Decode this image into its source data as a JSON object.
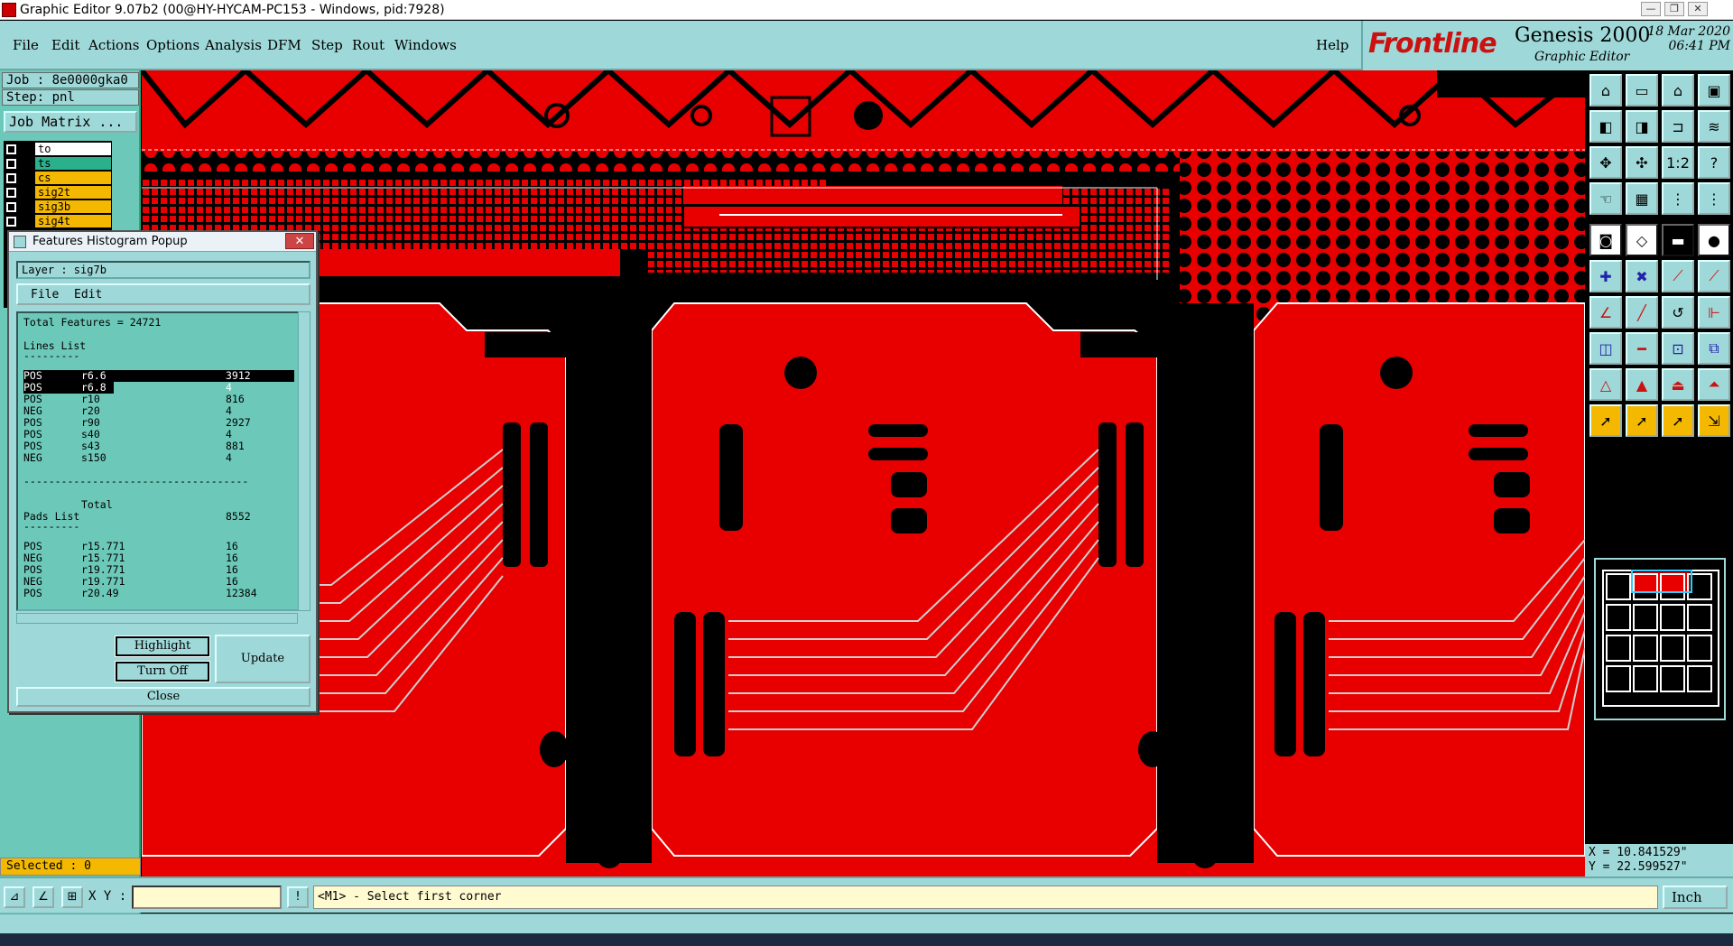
{
  "window": {
    "title": "Graphic Editor 9.07b2 (00@HY-HYCAM-PC153 - Windows, pid:7928)",
    "controls": [
      "—",
      "❐",
      "✕"
    ]
  },
  "menu": {
    "items": [
      "File",
      "Edit",
      "Actions",
      "Options",
      "Analysis",
      "DFM",
      "Step",
      "Rout",
      "Windows"
    ],
    "help": "Help"
  },
  "brand": {
    "logo": "Frontline",
    "product": "Genesis 2000",
    "subtitle": "Graphic Editor",
    "date": "18 Mar 2020",
    "time": "06:41 PM"
  },
  "job": {
    "job_label": "Job : 8e0000gka0",
    "step_label": "Step: pnl",
    "matrix_button": "Job Matrix ..."
  },
  "layers": [
    {
      "name": "to",
      "color": "#ffffff"
    },
    {
      "name": "ts",
      "color": "#2bb08c"
    },
    {
      "name": "cs",
      "color": "#f5b800"
    },
    {
      "name": "sig2t",
      "color": "#f5b800"
    },
    {
      "name": "sig3b",
      "color": "#f5b800"
    },
    {
      "name": "sig4t",
      "color": "#f5b800"
    }
  ],
  "selected": "Selected : 0",
  "popup": {
    "title": "Features Histogram Popup",
    "layer": "Layer :  sig7b",
    "menu": [
      "File",
      "Edit"
    ],
    "total_features": "Total Features = 24721",
    "lines_header": "Lines List",
    "lines_rule": "---------",
    "lines": [
      {
        "pol": "POS",
        "sym": "r6.6",
        "count": "3912",
        "highlighted": true
      },
      {
        "pol": "POS",
        "sym": "r6.8",
        "count": "4",
        "highlighted": true
      },
      {
        "pol": "POS",
        "sym": "r10",
        "count": "816"
      },
      {
        "pol": "NEG",
        "sym": "r20",
        "count": "4"
      },
      {
        "pol": "POS",
        "sym": "r90",
        "count": "2927"
      },
      {
        "pol": "POS",
        "sym": "s40",
        "count": "4"
      },
      {
        "pol": "POS",
        "sym": "s43",
        "count": "881"
      },
      {
        "pol": "NEG",
        "sym": "s150",
        "count": "4"
      }
    ],
    "total_rule": "------------------------------------",
    "total_label": "Total",
    "total_value": "8552",
    "pads_header": "Pads List",
    "pads_rule": "---------",
    "pads": [
      {
        "pol": "POS",
        "sym": "r15.771",
        "count": "16"
      },
      {
        "pol": "NEG",
        "sym": "r15.771",
        "count": "16"
      },
      {
        "pol": "POS",
        "sym": "r19.771",
        "count": "16"
      },
      {
        "pol": "NEG",
        "sym": "r19.771",
        "count": "16"
      },
      {
        "pol": "POS",
        "sym": "r20.49",
        "count": "12384"
      }
    ],
    "buttons": {
      "highlight": "Highlight",
      "turn_off": "Turn Off",
      "update": "Update",
      "close": "Close"
    }
  },
  "status": {
    "xy_label": "X Y :",
    "xy_value": "",
    "prompt": "<M1> - Select first corner",
    "units": "Inch"
  },
  "coords": {
    "x": "X = 10.841529\"",
    "y": "Y = 22.599527\""
  },
  "colors": {
    "panel": "#9fd8d8",
    "layer_teal": "#6cc8b8",
    "copper": "#e80000",
    "highlight_yellow": "#f5b800"
  }
}
